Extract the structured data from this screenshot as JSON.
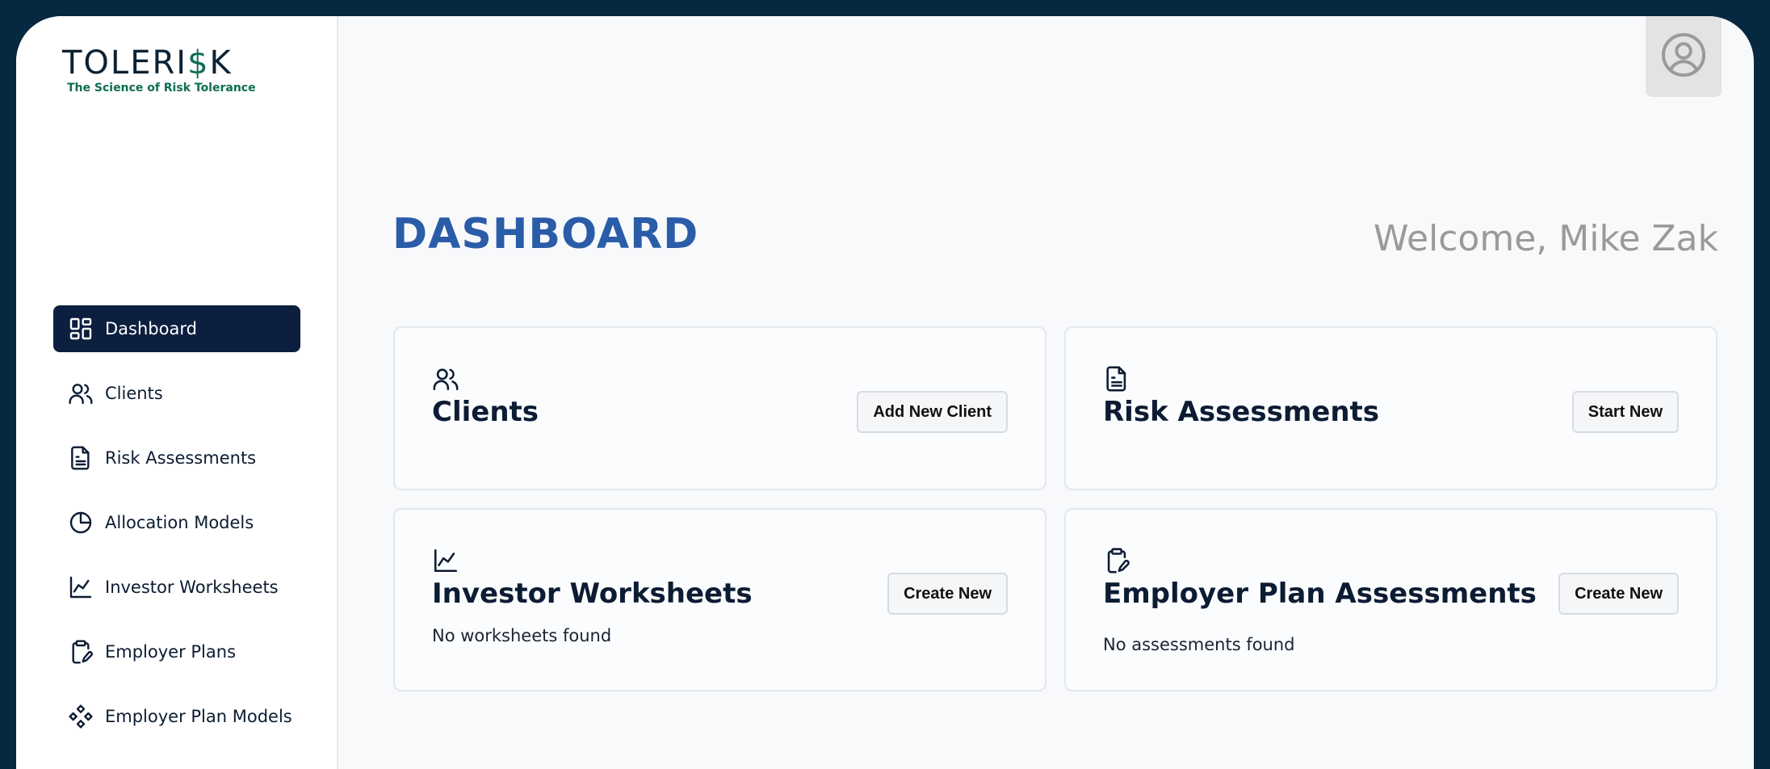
{
  "brand": {
    "name_pre": "TOLERI",
    "name_dollar": "$",
    "name_post": "K",
    "tagline": "The Science of Risk Tolerance"
  },
  "nav": {
    "items": [
      {
        "label": "Dashboard",
        "icon": "dashboard-icon",
        "active": true
      },
      {
        "label": "Clients",
        "icon": "users-icon"
      },
      {
        "label": "Risk Assessments",
        "icon": "document-icon"
      },
      {
        "label": "Allocation Models",
        "icon": "pie-chart-icon"
      },
      {
        "label": "Investor Worksheets",
        "icon": "line-chart-icon"
      },
      {
        "label": "Employer Plans",
        "icon": "clipboard-edit-icon"
      },
      {
        "label": "Employer Plan Models",
        "icon": "component-icon"
      }
    ]
  },
  "header": {
    "title": "DASHBOARD",
    "welcome": "Welcome, Mike Zak",
    "avatar_icon": "user-circle-icon"
  },
  "cards": {
    "clients": {
      "title": "Clients",
      "button": "Add New Client",
      "icon": "users-icon"
    },
    "risk": {
      "title": "Risk Assessments",
      "button": "Start New",
      "icon": "document-icon"
    },
    "worksheets": {
      "title": "Investor Worksheets",
      "button": "Create New",
      "empty": "No worksheets found",
      "icon": "line-chart-icon"
    },
    "employer": {
      "title": "Employer Plan Assessments",
      "button": "Create New",
      "empty": "No assessments found",
      "icon": "clipboard-edit-icon"
    }
  },
  "colors": {
    "frame": "#062840",
    "nav_active": "#0c1f3f",
    "title_blue": "#2a5ca8",
    "brand_green": "#0f6d55"
  }
}
